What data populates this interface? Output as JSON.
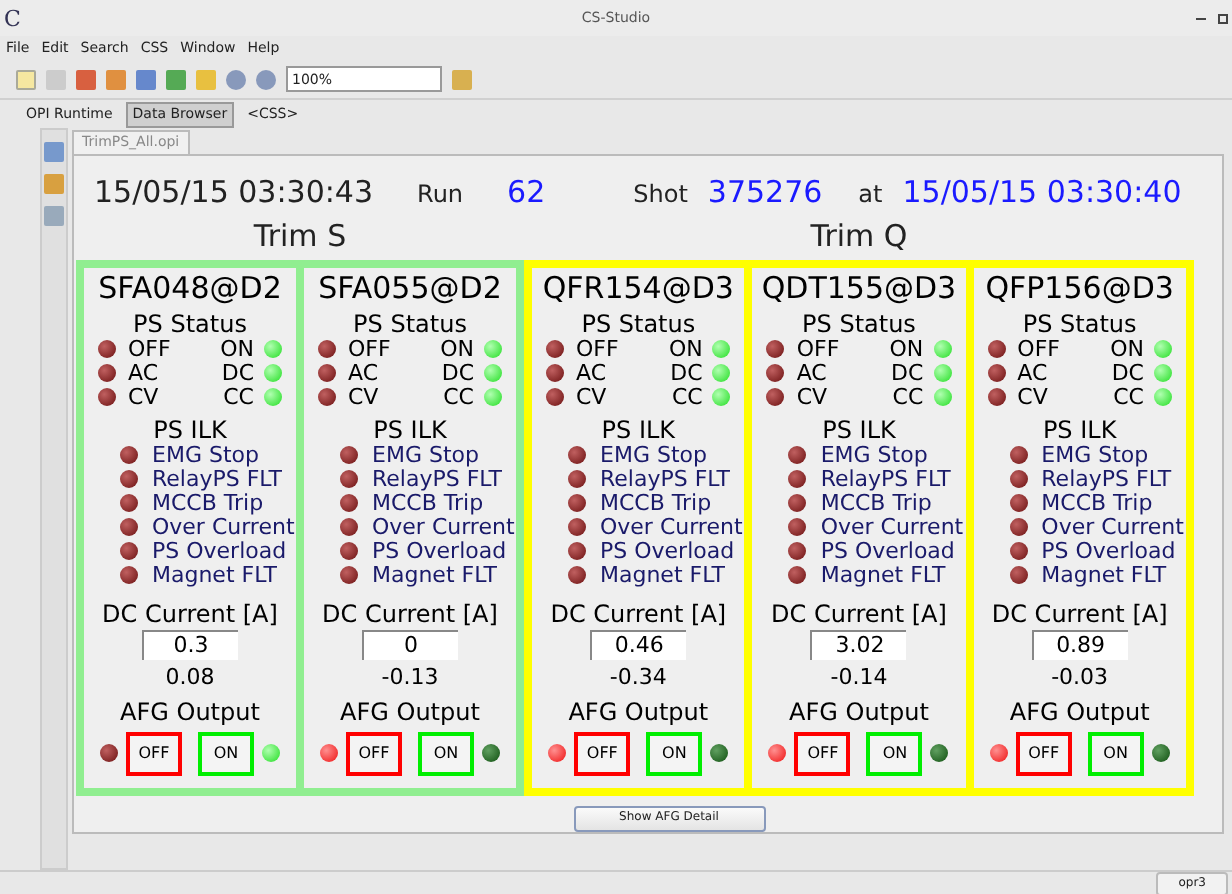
{
  "window": {
    "title": "CS-Studio",
    "logo": "C"
  },
  "menu": [
    "File",
    "Edit",
    "Search",
    "CSS",
    "Window",
    "Help"
  ],
  "toolbar": {
    "zoom": "100%"
  },
  "perspectives": [
    {
      "label": "OPI Runtime",
      "selected": false
    },
    {
      "label": "Data Browser",
      "selected": true
    },
    {
      "label": "<CSS>",
      "selected": false
    }
  ],
  "editor_tab": {
    "label": "TrimPS_All.opi"
  },
  "header": {
    "timestamp": "15/05/15 03:30:43",
    "run_label": "Run",
    "run": "62",
    "shot_label": "Shot",
    "shot": "375276",
    "at_label": "at",
    "shot_time": "15/05/15 03:30:40"
  },
  "groups": [
    {
      "title": "Trim S",
      "color": "#90ee90",
      "units": [
        {
          "name": "SFA048@D2",
          "status_title": "PS Status",
          "status": [
            {
              "left": "OFF",
              "left_on": false,
              "right": "ON",
              "right_on": true
            },
            {
              "left": "AC",
              "left_on": false,
              "right": "DC",
              "right_on": true
            },
            {
              "left": "CV",
              "left_on": false,
              "right": "CC",
              "right_on": true
            }
          ],
          "ilk_title": "PS ILK",
          "ilk": [
            {
              "label": "EMG Stop",
              "on": false
            },
            {
              "label": "RelayPS FLT",
              "on": false
            },
            {
              "label": "MCCB Trip",
              "on": false
            },
            {
              "label": "Over Current",
              "on": false
            },
            {
              "label": "PS Overload",
              "on": false
            },
            {
              "label": "Magnet FLT",
              "on": false
            }
          ],
          "dc_title": "DC Current [A]",
          "setpoint": "0.3",
          "readback": "0.08",
          "afg_title": "AFG Output",
          "off_button": "OFF",
          "on_button": "ON",
          "off_lamp": false,
          "on_lamp": true
        },
        {
          "name": "SFA055@D2",
          "status_title": "PS Status",
          "status": [
            {
              "left": "OFF",
              "left_on": false,
              "right": "ON",
              "right_on": true
            },
            {
              "left": "AC",
              "left_on": false,
              "right": "DC",
              "right_on": true
            },
            {
              "left": "CV",
              "left_on": false,
              "right": "CC",
              "right_on": true
            }
          ],
          "ilk_title": "PS ILK",
          "ilk": [
            {
              "label": "EMG Stop",
              "on": false
            },
            {
              "label": "RelayPS FLT",
              "on": false
            },
            {
              "label": "MCCB Trip",
              "on": false
            },
            {
              "label": "Over Current",
              "on": false
            },
            {
              "label": "PS Overload",
              "on": false
            },
            {
              "label": "Magnet FLT",
              "on": false
            }
          ],
          "dc_title": "DC Current [A]",
          "setpoint": "0",
          "readback": "-0.13",
          "afg_title": "AFG Output",
          "off_button": "OFF",
          "on_button": "ON",
          "off_lamp": true,
          "on_lamp": false
        }
      ]
    },
    {
      "title": "Trim Q",
      "color": "#ffff00",
      "units": [
        {
          "name": "QFR154@D3",
          "status_title": "PS Status",
          "status": [
            {
              "left": "OFF",
              "left_on": false,
              "right": "ON",
              "right_on": true
            },
            {
              "left": "AC",
              "left_on": false,
              "right": "DC",
              "right_on": true
            },
            {
              "left": "CV",
              "left_on": false,
              "right": "CC",
              "right_on": true
            }
          ],
          "ilk_title": "PS ILK",
          "ilk": [
            {
              "label": "EMG Stop",
              "on": false
            },
            {
              "label": "RelayPS FLT",
              "on": false
            },
            {
              "label": "MCCB Trip",
              "on": false
            },
            {
              "label": "Over Current",
              "on": false
            },
            {
              "label": "PS Overload",
              "on": false
            },
            {
              "label": "Magnet FLT",
              "on": false
            }
          ],
          "dc_title": "DC Current [A]",
          "setpoint": "0.46",
          "readback": "-0.34",
          "afg_title": "AFG Output",
          "off_button": "OFF",
          "on_button": "ON",
          "off_lamp": true,
          "on_lamp": false
        },
        {
          "name": "QDT155@D3",
          "status_title": "PS Status",
          "status": [
            {
              "left": "OFF",
              "left_on": false,
              "right": "ON",
              "right_on": true
            },
            {
              "left": "AC",
              "left_on": false,
              "right": "DC",
              "right_on": true
            },
            {
              "left": "CV",
              "left_on": false,
              "right": "CC",
              "right_on": true
            }
          ],
          "ilk_title": "PS ILK",
          "ilk": [
            {
              "label": "EMG Stop",
              "on": false
            },
            {
              "label": "RelayPS FLT",
              "on": false
            },
            {
              "label": "MCCB Trip",
              "on": false
            },
            {
              "label": "Over Current",
              "on": false
            },
            {
              "label": "PS Overload",
              "on": false
            },
            {
              "label": "Magnet FLT",
              "on": false
            }
          ],
          "dc_title": "DC Current [A]",
          "setpoint": "3.02",
          "readback": "-0.14",
          "afg_title": "AFG Output",
          "off_button": "OFF",
          "on_button": "ON",
          "off_lamp": true,
          "on_lamp": false
        },
        {
          "name": "QFP156@D3",
          "status_title": "PS Status",
          "status": [
            {
              "left": "OFF",
              "left_on": false,
              "right": "ON",
              "right_on": true
            },
            {
              "left": "AC",
              "left_on": false,
              "right": "DC",
              "right_on": true
            },
            {
              "left": "CV",
              "left_on": false,
              "right": "CC",
              "right_on": true
            }
          ],
          "ilk_title": "PS ILK",
          "ilk": [
            {
              "label": "EMG Stop",
              "on": false
            },
            {
              "label": "RelayPS FLT",
              "on": false
            },
            {
              "label": "MCCB Trip",
              "on": false
            },
            {
              "label": "Over Current",
              "on": false
            },
            {
              "label": "PS Overload",
              "on": false
            },
            {
              "label": "Magnet FLT",
              "on": false
            }
          ],
          "dc_title": "DC Current [A]",
          "setpoint": "0.89",
          "readback": "-0.03",
          "afg_title": "AFG Output",
          "off_button": "OFF",
          "on_button": "ON",
          "off_lamp": true,
          "on_lamp": false
        }
      ]
    }
  ],
  "detail_button": "Show AFG Detail",
  "status_bar": {
    "user": "opr3"
  }
}
